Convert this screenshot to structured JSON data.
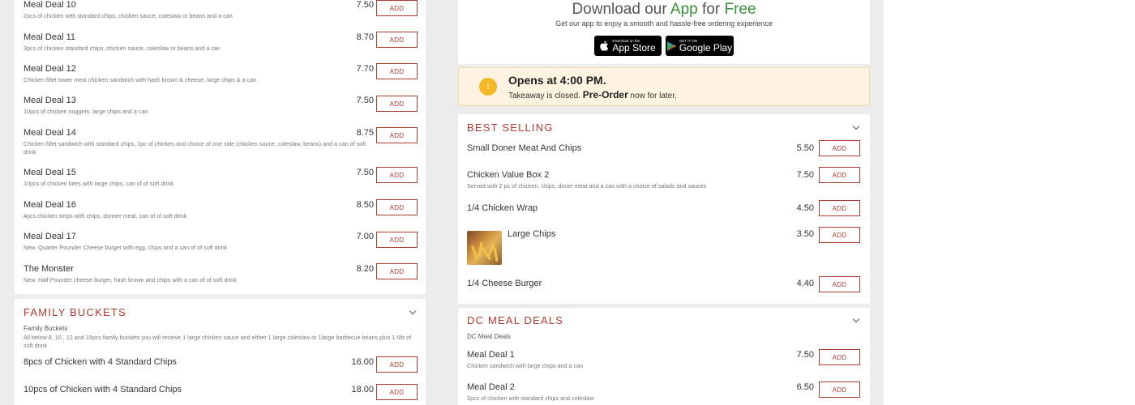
{
  "left": {
    "top_items": [
      {
        "name": "Meal Deal 10",
        "desc": "2pcs of chicken with standard chips, chicken sauce, coleslaw or beans and a can",
        "price": "7.50",
        "add": "ADD"
      },
      {
        "name": "Meal Deal 11",
        "desc": "3pcs of chicken standard chips, chicken sauce, coleslaw or beans and a can",
        "price": "8.70",
        "add": "ADD"
      },
      {
        "name": "Meal Deal 12",
        "desc": "Chicken fillet tower meal chicken sandwich with hash brown & cheese, large chips & a can",
        "price": "7.70",
        "add": "ADD"
      },
      {
        "name": "Meal Deal 13",
        "desc": "10pcs of chicken nuggets, large chips and a can",
        "price": "7.50",
        "add": "ADD"
      },
      {
        "name": "Meal Deal 14",
        "desc": "Chicken fillet sandwich with standard chips, 1pc of chicken and choice of one side (chicken sauce, coleslaw, beans) and a can of soft drink",
        "price": "8.75",
        "add": "ADD"
      },
      {
        "name": "Meal Deal 15",
        "desc": "10pcs of chicken bites with large chips, can of of soft drink",
        "price": "7.50",
        "add": "ADD"
      },
      {
        "name": "Meal Deal 16",
        "desc": "4pcs chicken strips with chips, donner meat, can of of soft drink",
        "price": "8.50",
        "add": "ADD"
      },
      {
        "name": "Meal Deal 17",
        "desc": "New. Quarter Pounder Cheese burger with egg, chips and a can of of soft drink",
        "price": "7.00",
        "add": "ADD"
      },
      {
        "name": "The Monster",
        "desc": "New. Half Pounder cheese burger, hash brown and chips with a can of of soft drink",
        "price": "8.20",
        "add": "ADD"
      }
    ],
    "family": {
      "title": "FAMILY BUCKETS",
      "intro_title": "Family Buckets",
      "intro_desc": "All below 8, 10 , 12 and 15pcs family buckets you will receive 1 large chicken sauce and either 1 large coleslaw or 1large barbecue beans plus 1.5ltr of soft drink",
      "items": [
        {
          "name": "8pcs of Chicken with 4 Standard Chips",
          "price": "16.00",
          "add": "ADD"
        },
        {
          "name": "10pcs of Chicken with 4 Standard Chips",
          "price": "18.00",
          "add": "ADD"
        }
      ]
    }
  },
  "app": {
    "title_pre": "Download our",
    "title_app": "App",
    "title_mid": "for",
    "title_free": "Free",
    "subtitle": "Get our app to enjoy a smooth and hassle-free ordering experience",
    "appstore_small": "Download on the",
    "appstore_big": "App Store",
    "gplay_small": "GET IT ON",
    "gplay_big": "Google Play"
  },
  "notice": {
    "icon": "!",
    "heading": "Opens at 4:00 PM.",
    "sub_pre": "Takeaway is closed.",
    "sub_bold": "Pre-Order",
    "sub_post": "now for later."
  },
  "best": {
    "title": "BEST SELLING",
    "items": [
      {
        "name": "Small Doner Meat And Chips",
        "desc": "",
        "price": "5.50",
        "add": "ADD"
      },
      {
        "name": "Chicken Value Box 2",
        "desc": "Served with 2 pc of chicken, chips, doner meat and a can with a choice of salads and sauces",
        "price": "7.50",
        "add": "ADD"
      },
      {
        "name": "1/4 Chicken Wrap",
        "desc": "",
        "price": "4.50",
        "add": "ADD"
      },
      {
        "name": "Large Chips",
        "desc": "",
        "price": "3.50",
        "add": "ADD"
      },
      {
        "name": "1/4 Cheese Burger",
        "desc": "",
        "price": "4.40",
        "add": "ADD"
      }
    ]
  },
  "dc": {
    "title": "DC MEAL DEALS",
    "subtitle": "DC Meal Deals",
    "items": [
      {
        "name": "Meal Deal 1",
        "desc": "Chicken sandwich with large chips and a can",
        "price": "7.50",
        "add": "ADD"
      },
      {
        "name": "Meal Deal 2",
        "desc": "2pcs of chicken with standard chips and coleslaw",
        "price": "6.50",
        "add": "ADD"
      }
    ]
  }
}
